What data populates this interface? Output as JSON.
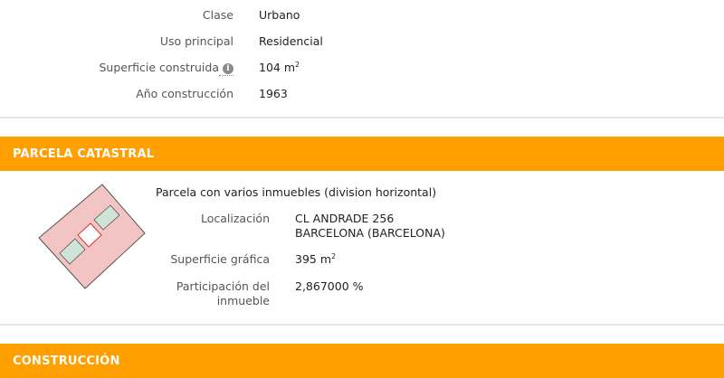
{
  "inmueble": {
    "clase_label": "Clase",
    "clase_value": "Urbano",
    "uso_label": "Uso principal",
    "uso_value": "Residencial",
    "superficie_label": "Superficie construida",
    "superficie_value": "104 m",
    "superficie_unit_exp": "2",
    "anio_label": "Año construcción",
    "anio_value": "1963"
  },
  "parcela": {
    "section_title": "PARCELA CATASTRAL",
    "description": "Parcela con varios inmuebles (division horizontal)",
    "localizacion_label": "Localización",
    "localizacion_line1": "CL ANDRADE 256",
    "localizacion_line2": "BARCELONA (BARCELONA)",
    "superficie_grafica_label": "Superficie gráfica",
    "superficie_grafica_value": "395 m",
    "superficie_grafica_exp": "2",
    "participacion_label_line1": "Participación del",
    "participacion_label_line2": "inmueble",
    "participacion_value": "2,867000 %"
  },
  "construccion": {
    "section_title": "CONSTRUCCIÓN"
  },
  "colors": {
    "accent": "#ff9f00",
    "parcel_fill": "#f2c4c4",
    "parcel_stroke": "#555555",
    "building_fill": "#cfe3d8",
    "highlight_stroke": "#e03030"
  },
  "icons": {
    "info": "info-icon",
    "parcel_map": "parcel-map-icon"
  }
}
